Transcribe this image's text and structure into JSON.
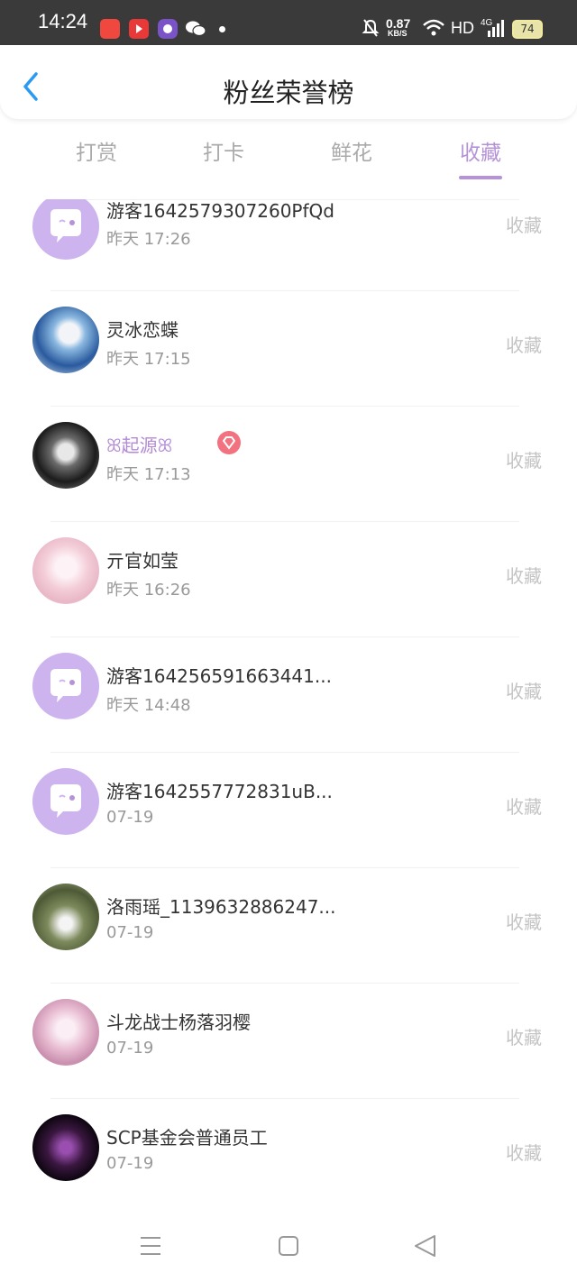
{
  "status_bar": {
    "time": "14:24",
    "network_speed_value": "0.87",
    "network_speed_unit": "KB/S",
    "hd": "HD",
    "signal": "4G",
    "battery": "74"
  },
  "header": {
    "title": "粉丝荣誉榜"
  },
  "tabs": [
    {
      "label": "打赏"
    },
    {
      "label": "打卡"
    },
    {
      "label": "鲜花"
    },
    {
      "label": "收藏"
    }
  ],
  "active_tab": "收藏",
  "accent_color": "#b693d9",
  "list": [
    {
      "name": "游客1642579307260PfQd",
      "time": "昨天 17:26",
      "action": "收藏",
      "avatar": "guest-avatar"
    },
    {
      "name": "灵冰恋蝶",
      "time": "昨天 17:15",
      "action": "收藏",
      "avatar": "photo-avatar"
    },
    {
      "name": "ꕤ起源ꕤ",
      "time": "昨天 17:13",
      "action": "收藏",
      "avatar": "photo-avatar"
    },
    {
      "name": "亓官如莹",
      "time": "昨天 16:26",
      "action": "收藏",
      "avatar": "photo-avatar"
    },
    {
      "name": "游客164256591663441...",
      "time": "昨天 14:48",
      "action": "收藏",
      "avatar": "guest-avatar"
    },
    {
      "name": "游客1642557772831uB...",
      "time": "07-19",
      "action": "收藏",
      "avatar": "guest-avatar"
    },
    {
      "name": "洛雨瑶_1139632886247...",
      "time": "07-19",
      "action": "收藏",
      "avatar": "photo-avatar"
    },
    {
      "name": "斗龙战士杨落羽樱",
      "time": "07-19",
      "action": "收藏",
      "avatar": "photo-avatar"
    },
    {
      "name": "SCP基金会普通员工",
      "time": "07-19",
      "action": "收藏",
      "avatar": "photo-avatar"
    }
  ]
}
